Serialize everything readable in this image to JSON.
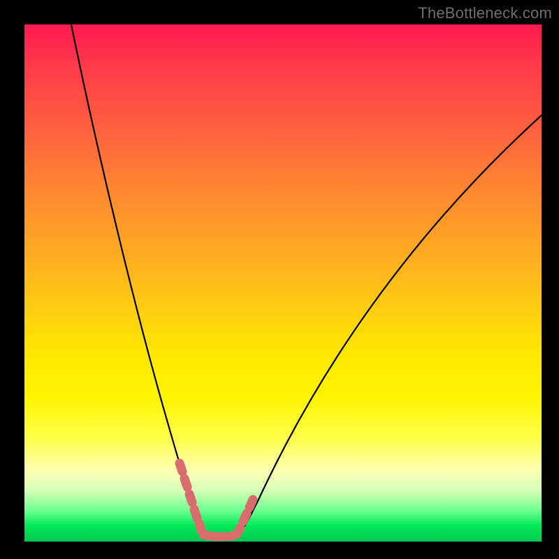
{
  "watermark": "TheBottleneck.com",
  "chart_data": {
    "type": "line",
    "title": "",
    "xlabel": "",
    "ylabel": "",
    "xlim": [
      0,
      100
    ],
    "ylim": [
      0,
      100
    ],
    "series": [
      {
        "name": "bottleneck-curve",
        "x": [
          0,
          5,
          10,
          15,
          20,
          25,
          28,
          30,
          32,
          34,
          36,
          38,
          40,
          45,
          50,
          55,
          60,
          65,
          70,
          75,
          80,
          85,
          90,
          95,
          100
        ],
        "values": [
          120,
          100,
          80,
          62,
          46,
          30,
          18,
          10,
          4,
          0,
          0,
          0,
          3,
          12,
          22,
          32,
          42,
          51,
          60,
          68,
          75,
          81,
          86,
          90,
          94
        ]
      }
    ],
    "highlight_segment": {
      "name": "optimal-range",
      "x": [
        28,
        30,
        32,
        34,
        36,
        38,
        40
      ],
      "values": [
        18,
        10,
        4,
        0,
        0,
        0,
        3
      ]
    },
    "colors": {
      "curve": "#000000",
      "highlight": "#d96d6d",
      "gradient_top": "#ff1a4f",
      "gradient_mid": "#fff400",
      "gradient_bottom": "#00c850",
      "frame": "#000000"
    }
  }
}
